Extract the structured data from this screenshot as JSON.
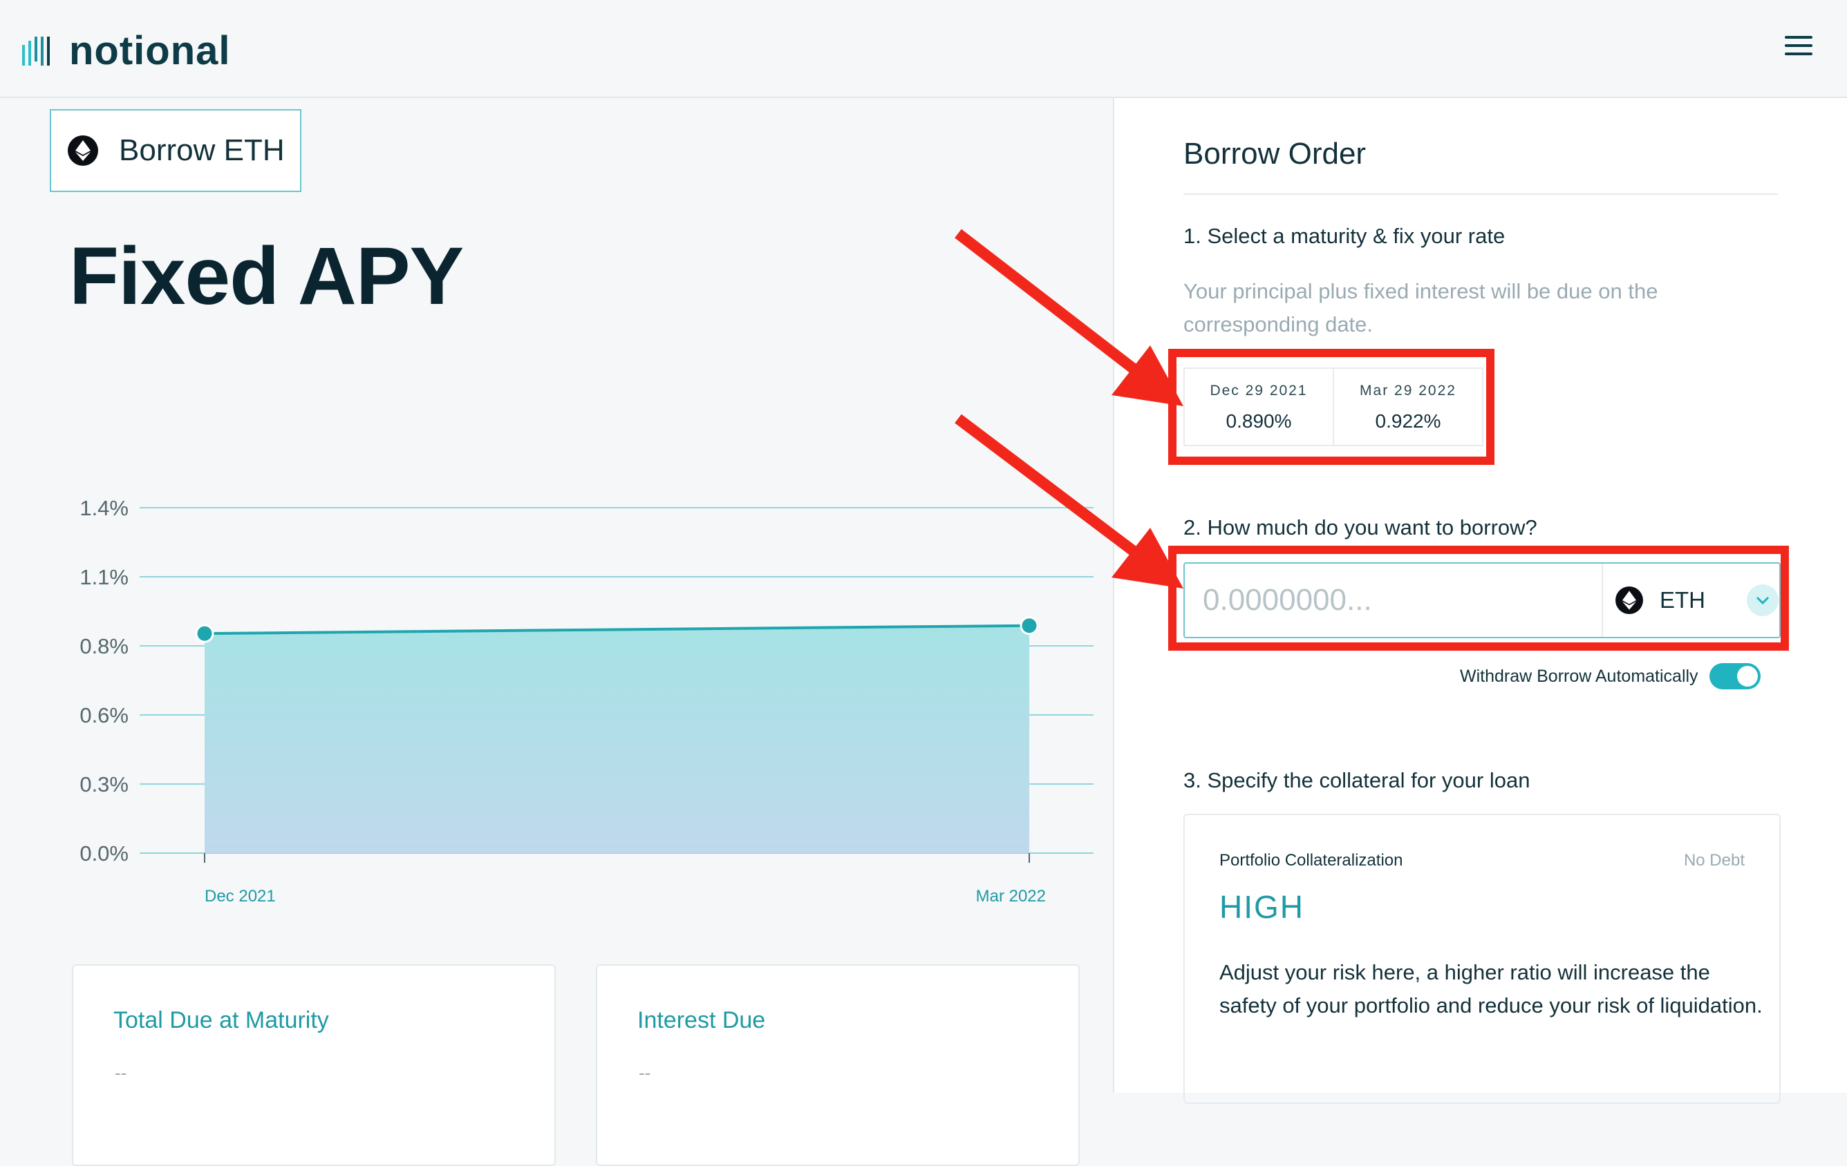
{
  "header": {
    "logo_text": "notional",
    "menu_icon": "hamburger-menu-icon"
  },
  "asset": {
    "label": "Borrow ETH",
    "icon": "ethereum-icon"
  },
  "page_title": "Fixed APY",
  "chart_data": {
    "type": "area",
    "x": [
      "Dec 2021",
      "Mar 2022"
    ],
    "values": [
      0.89,
      0.922
    ],
    "y_ticks": [
      "1.4%",
      "1.1%",
      "0.8%",
      "0.6%",
      "0.3%",
      "0.0%"
    ],
    "ylim": [
      0,
      1.4
    ],
    "grid": true,
    "fill_colors": [
      "#a6e2e5",
      "#bfd9ec"
    ],
    "line_color": "#1fa5ae"
  },
  "cards": [
    {
      "title": "Total Due at Maturity",
      "value": "--"
    },
    {
      "title": "Interest Due",
      "value": "--"
    }
  ],
  "order": {
    "title": "Borrow Order",
    "step1": {
      "label": "1. Select a maturity & fix your rate",
      "help": "Your principal plus fixed interest will be due on the corresponding date.",
      "maturities": [
        {
          "date": "Dec 29 2021",
          "rate": "0.890%"
        },
        {
          "date": "Mar 29 2022",
          "rate": "0.922%"
        }
      ]
    },
    "step2": {
      "label": "2. How much do you want to borrow?",
      "placeholder": "0.0000000...",
      "currency": "ETH",
      "toggle_label": "Withdraw Borrow Automatically",
      "toggle_on": true
    },
    "step3": {
      "label": "3. Specify the collateral for your loan",
      "heading": "Portfolio Collateralization",
      "debt_status": "No Debt",
      "level": "HIGH",
      "description": "Adjust your risk here, a higher ratio will increase the safety of your portfolio and reduce your risk of liquidation."
    }
  },
  "colors": {
    "accent": "#1e9aa4",
    "annotation": "#f2271c"
  }
}
